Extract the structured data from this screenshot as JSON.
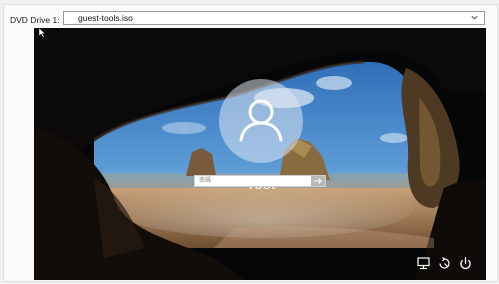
{
  "media": {
    "drive_label": "DVD Drive 1:",
    "selected_iso": "guest-tools.iso"
  },
  "lock_screen": {
    "user_name": "Test",
    "password_placeholder": "密碼",
    "icons": {
      "network": "network-icon",
      "ease_of_access": "ease-of-access-icon",
      "power": "power-icon",
      "submit": "arrow-right-icon",
      "avatar": "user-silhouette-icon"
    }
  },
  "colors": {
    "panel_bg": "#fafafa",
    "screen_bg": "#050608",
    "sky": "#4a86c8",
    "sand": "#b88a5c",
    "text_on_screen": "#ffffff"
  }
}
